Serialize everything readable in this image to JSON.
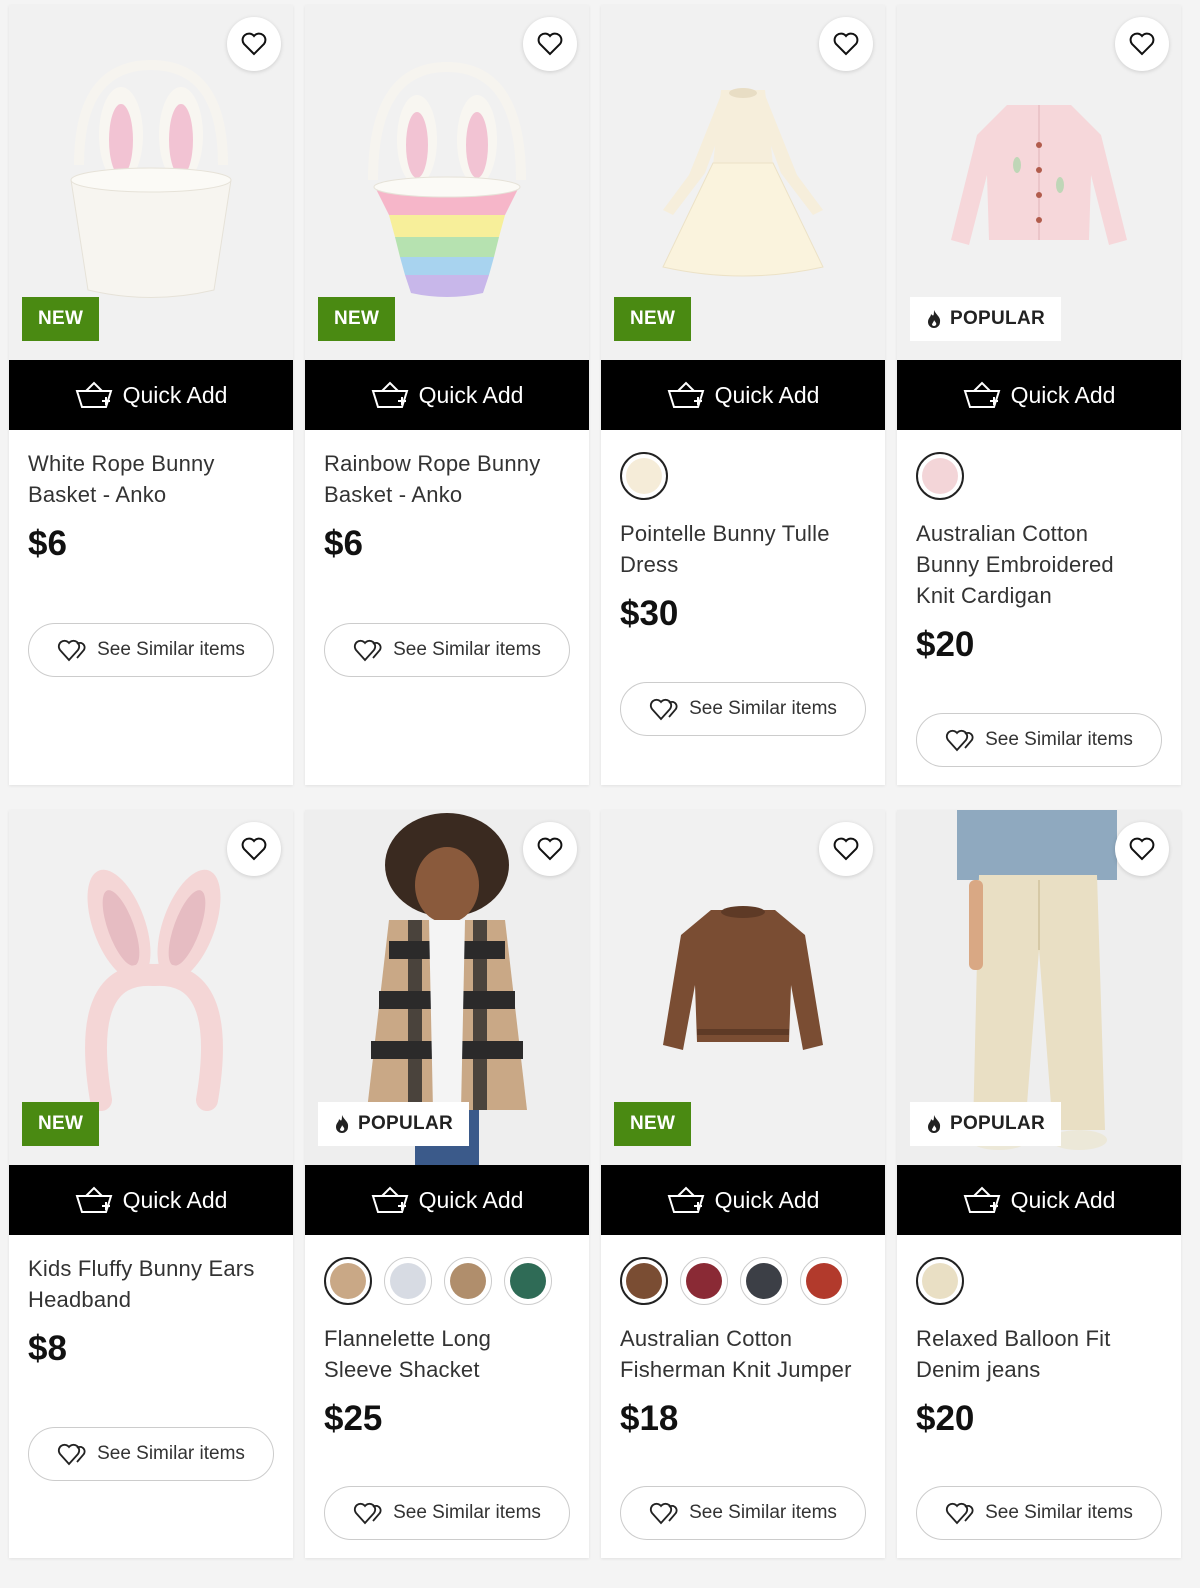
{
  "labels": {
    "quick_add": "Quick Add",
    "see_similar": "See Similar items",
    "badge_new": "NEW",
    "badge_popular": "POPULAR"
  },
  "colors": {
    "badge_new_bg": "#4a8a12",
    "quick_add_bg": "#000000",
    "image_bg": "#f0f0f0"
  },
  "products": [
    {
      "title": "White Rope Bunny Basket - Anko",
      "price": "$6",
      "badge": "NEW",
      "swatches": []
    },
    {
      "title": "Rainbow Rope Bunny Basket - Anko",
      "price": "$6",
      "badge": "NEW",
      "swatches": []
    },
    {
      "title": "Pointelle Bunny Tulle Dress",
      "price": "$30",
      "badge": "NEW",
      "swatches": [
        "#f5ecd8"
      ]
    },
    {
      "title": "Australian Cotton Bunny Embroidered Knit Cardigan",
      "price": "$20",
      "badge": "POPULAR",
      "swatches": [
        "#f3d5d8"
      ]
    },
    {
      "title": "Kids Fluffy Bunny Ears Headband",
      "price": "$8",
      "badge": "NEW",
      "swatches": []
    },
    {
      "title": "Flannelette Long Sleeve Shacket",
      "price": "$25",
      "badge": "POPULAR",
      "swatches": [
        "#c9a886",
        "#d7dbe3",
        "#b08e6c",
        "#2f6b56"
      ]
    },
    {
      "title": "Australian Cotton Fisherman Knit Jumper",
      "price": "$18",
      "badge": "NEW",
      "swatches": [
        "#7a4d33",
        "#8a2a35",
        "#3c3f46",
        "#b23a2c"
      ]
    },
    {
      "title": "Relaxed Balloon Fit Denim jeans",
      "price": "$20",
      "badge": "POPULAR",
      "swatches": [
        "#e9dfc4"
      ]
    }
  ],
  "icons": {
    "favourite": "heart-icon",
    "quick_add": "basket-plus-icon",
    "similar": "hearts-icon",
    "popular": "flame-icon"
  }
}
